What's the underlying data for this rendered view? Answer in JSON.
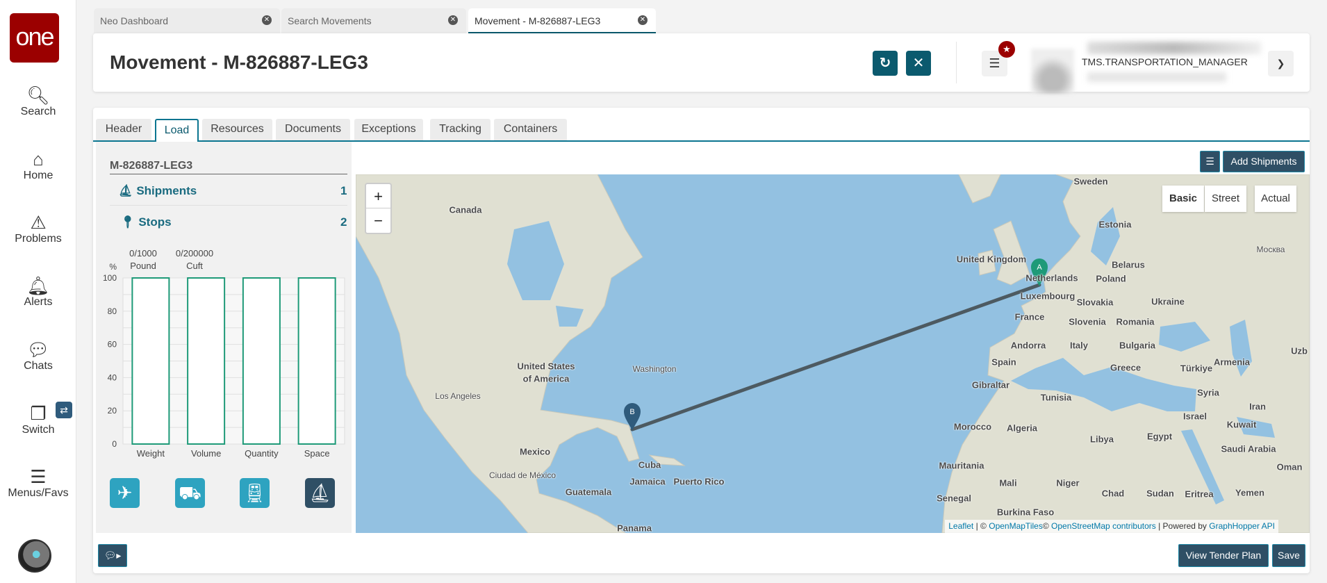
{
  "sidebar": {
    "logo": "one",
    "items": [
      {
        "label": "Search",
        "icon": "search-icon"
      },
      {
        "label": "Home",
        "icon": "home-icon"
      },
      {
        "label": "Problems",
        "icon": "warning-icon"
      },
      {
        "label": "Alerts",
        "icon": "bell-icon"
      },
      {
        "label": "Chats",
        "icon": "chat-icon"
      },
      {
        "label": "Switch",
        "icon": "switch-icon"
      },
      {
        "label": "Menus/Favs",
        "icon": "menu-icon"
      }
    ]
  },
  "tabs": [
    {
      "label": "Neo Dashboard"
    },
    {
      "label": "Search Movements"
    },
    {
      "label": "Movement - M-826887-LEG3",
      "active": true
    }
  ],
  "header": {
    "title": "Movement - M-826887-LEG3",
    "user_role": "TMS.TRANSPORTATION_MANAGER"
  },
  "content_tabs": [
    {
      "label": "Header"
    },
    {
      "label": "Load",
      "active": true
    },
    {
      "label": "Resources"
    },
    {
      "label": "Documents"
    },
    {
      "label": "Exceptions"
    },
    {
      "label": "Tracking"
    },
    {
      "label": "Containers"
    }
  ],
  "load": {
    "movement_id": "M-826887-LEG3",
    "shipments_label": "Shipments",
    "shipments_count": "1",
    "stops_label": "Stops",
    "stops_count": "2"
  },
  "chart_data": {
    "type": "bar",
    "ylabel": "%",
    "ylim": [
      0,
      100
    ],
    "yticks": [
      "100",
      "80",
      "60",
      "40",
      "20",
      "0"
    ],
    "categories": [
      "Weight",
      "Volume",
      "Quantity",
      "Space"
    ],
    "values": [
      0,
      0,
      0,
      0
    ],
    "capacity_labels": [
      {
        "value": "0/1000",
        "unit": "Pound"
      },
      {
        "value": "0/200000",
        "unit": "Cuft"
      }
    ],
    "bar_outline_color": "#1e9a78"
  },
  "modes": [
    {
      "icon": "airplane-icon"
    },
    {
      "icon": "truck-icon"
    },
    {
      "icon": "train-icon"
    },
    {
      "icon": "ship-icon",
      "selected": true
    }
  ],
  "map": {
    "add_shipments": "Add Shipments",
    "layers": [
      "Basic",
      "Street",
      "Actual"
    ],
    "active_layer": "Basic",
    "zoom_in": "+",
    "zoom_out": "−",
    "markers": [
      {
        "label": "A",
        "color": "#1e9a78"
      },
      {
        "label": "B",
        "color": "#2f5b7c"
      }
    ],
    "labels": [
      "Canada",
      "United States",
      "of America",
      "Washington",
      "Los Angeles",
      "Mexico",
      "Ciudad de México",
      "Cuba",
      "Jamaica",
      "Puerto Rico",
      "Guatemala",
      "Panama",
      "Sweden",
      "Estonia",
      "Москва",
      "United Kingdom",
      "Netherlands",
      "Belarus",
      "Poland",
      "Luxembourg",
      "Slovakia",
      "Ukraine",
      "France",
      "Slovenia",
      "Romania",
      "Andorra",
      "Italy",
      "Bulgaria",
      "Uzb",
      "Spain",
      "Greece",
      "Türkiye",
      "Armenia",
      "Gibraltar",
      "Syria",
      "Tunisia",
      "Iran",
      "Israel",
      "Kuwait",
      "Morocco",
      "Algeria",
      "Libya",
      "Egypt",
      "Saudi Arabia",
      "Mauritania",
      "Oman",
      "Mali",
      "Niger",
      "Chad",
      "Sudan",
      "Eritrea",
      "Yemen",
      "Senegal",
      "Burkina Faso"
    ],
    "attribution": {
      "leaflet": "Leaflet",
      "sep1": " | © ",
      "omt": "OpenMapTiles",
      "c": "© ",
      "osm": "OpenStreetMap contributors",
      "sep2": " | Powered by ",
      "gh": "GraphHopper API"
    }
  },
  "footer": {
    "view_tender_plan": "View Tender Plan",
    "save": "Save"
  },
  "colors": {
    "brand": "#9b0000",
    "primary": "#0b5a6e",
    "dark_button": "#2f4f65"
  }
}
